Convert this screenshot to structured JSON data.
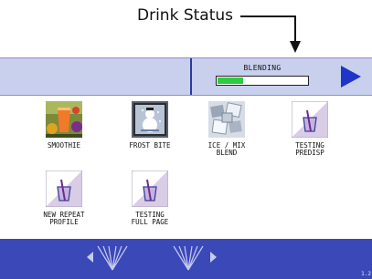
{
  "callout": {
    "title": "Drink Status"
  },
  "header": {
    "status_label": "BLENDING",
    "progress_fraction": 0.3,
    "progress_color": "#2ecc40",
    "next_icon": "play-right-icon"
  },
  "tiles": [
    {
      "label": "SMOOTHIE",
      "icon": "smoothie-photo-icon"
    },
    {
      "label": "FROST BITE",
      "icon": "snowman-photo-icon"
    },
    {
      "label": "ICE / MIX\nBLEND",
      "icon": "ice-cubes-photo-icon"
    },
    {
      "label": "TESTING\nPREDISP",
      "icon": "cup-straw-icon"
    },
    {
      "label": "NEW REPEAT\nPROFILE",
      "icon": "cup-straw-icon"
    },
    {
      "label": "TESTING\nFULL PAGE",
      "icon": "cup-straw-icon"
    }
  ],
  "footer": {
    "left_icon": "page-left-icon",
    "right_icon": "page-right-icon",
    "version": "1.2"
  },
  "colors": {
    "header_bg": "#c8d0ee",
    "footer_bg": "#3a48b8",
    "accent": "#1f34c9"
  }
}
